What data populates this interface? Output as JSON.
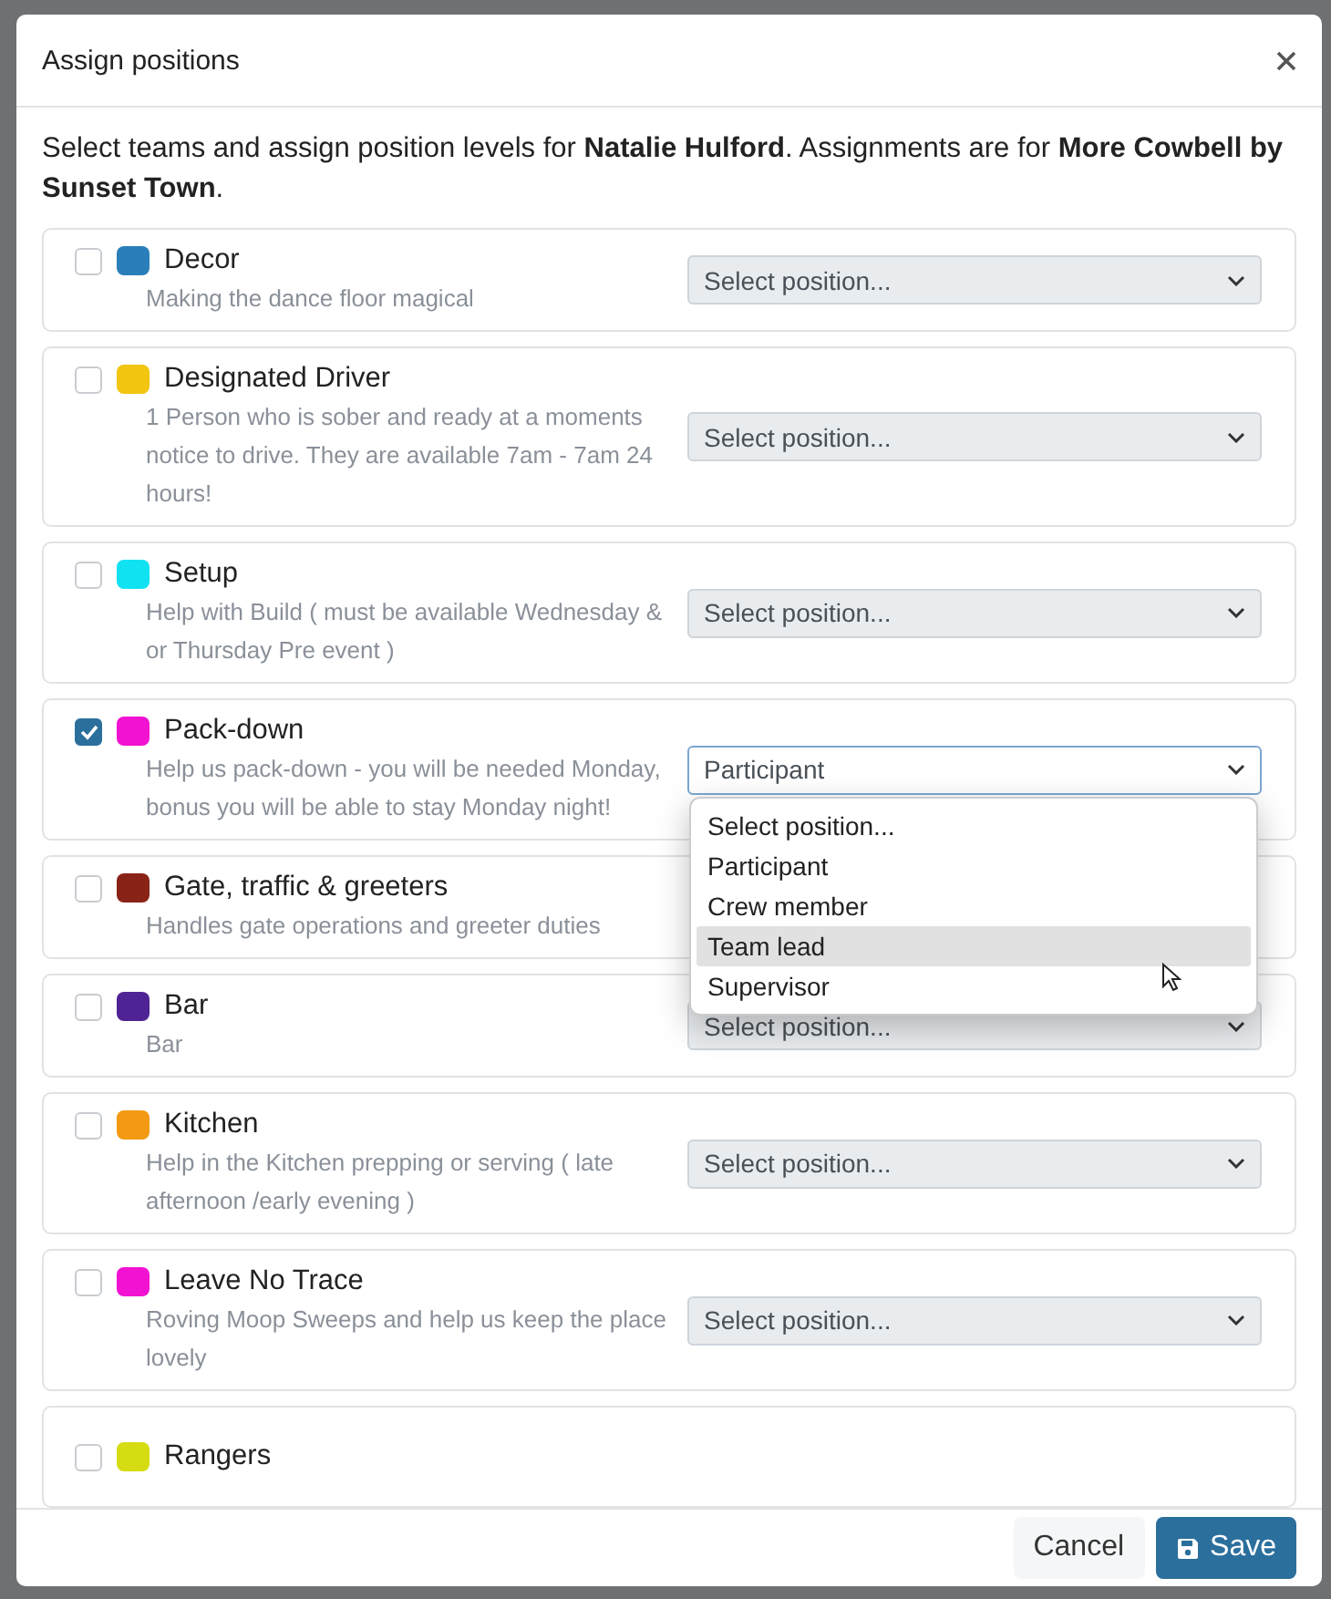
{
  "dialog": {
    "title": "Assign positions"
  },
  "intro": "Select teams and assign position levels for **Natalie Hulford**. Assignments are for **More Cowbell by Sunset Town**.",
  "teams": [
    {
      "name": "Decor",
      "description": "Making the dance floor magical",
      "color": "#2a7fba",
      "checked": false,
      "position": "Select position...",
      "dropdown_open": false
    },
    {
      "name": "Designated Driver",
      "description": "1 Person who is sober and ready at a moments notice to drive. They are available 7am - 7am 24 hours!",
      "color": "#f2c511",
      "checked": false,
      "position": "Select position...",
      "dropdown_open": false
    },
    {
      "name": "Setup",
      "description": "Help with Build ( must be available Wednesday & or Thursday Pre event )",
      "color": "#11e2f2",
      "checked": false,
      "position": "Select position...",
      "dropdown_open": false
    },
    {
      "name": "Pack-down",
      "description": "Help us pack-down - you will be needed Monday, bonus you will be able to stay Monday night!",
      "color": "#f212d2",
      "checked": true,
      "position": "Participant",
      "dropdown_open": true
    },
    {
      "name": "Gate, traffic & greeters",
      "description": "Handles gate operations and greeter duties",
      "color": "#8a2317",
      "checked": false
    },
    {
      "name": "Bar",
      "description": "Bar",
      "color": "#4f2394",
      "checked": false,
      "position": "Select position...",
      "dropdown_open": false
    },
    {
      "name": "Kitchen",
      "description": "Help in the Kitchen prepping or serving ( late afternoon /early evening )",
      "color": "#f39a12",
      "checked": false,
      "position": "Select position...",
      "dropdown_open": false
    },
    {
      "name": "Leave No Trace",
      "description": "Roving Moop Sweeps and help us keep the place lovely",
      "color": "#f212d2",
      "checked": false,
      "position": "Select position...",
      "dropdown_open": false
    },
    {
      "name": "Rangers",
      "color": "#d6dc12",
      "checked": false
    }
  ],
  "position_options": [
    {
      "label": "Select position...",
      "highlighted": false
    },
    {
      "label": "Participant",
      "highlighted": false
    },
    {
      "label": "Crew member",
      "highlighted": false
    },
    {
      "label": "Team lead",
      "highlighted": true
    },
    {
      "label": "Supervisor",
      "highlighted": false
    }
  ],
  "buttons": [
    {
      "label": "Cancel",
      "kind": "secondary"
    },
    {
      "label": "Save",
      "kind": "primary"
    }
  ]
}
